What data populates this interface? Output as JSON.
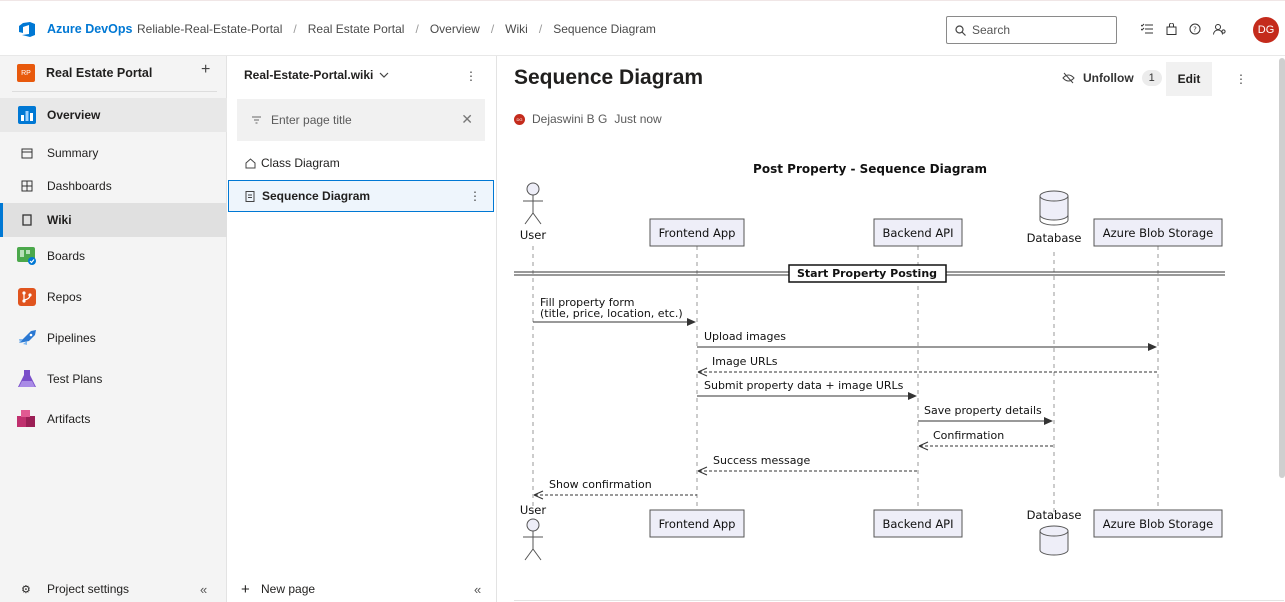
{
  "brand": "Azure DevOps",
  "breadcrumb": [
    "Reliable-Real-Estate-Portal",
    "Real Estate Portal",
    "Overview",
    "Wiki",
    "Sequence Diagram"
  ],
  "search": {
    "placeholder": "Search"
  },
  "user_initials": "DG",
  "project": {
    "badge": "RP",
    "name": "Real Estate Portal"
  },
  "nav": [
    {
      "label": "Overview",
      "icon": "overview-icon"
    },
    {
      "label": "Summary",
      "icon": "summary-icon"
    },
    {
      "label": "Dashboards",
      "icon": "dashboards-icon"
    },
    {
      "label": "Wiki",
      "icon": "wiki-icon"
    },
    {
      "label": "Boards",
      "icon": "boards-icon"
    },
    {
      "label": "Repos",
      "icon": "repos-icon"
    },
    {
      "label": "Pipelines",
      "icon": "pipelines-icon"
    },
    {
      "label": "Test Plans",
      "icon": "test-plans-icon"
    },
    {
      "label": "Artifacts",
      "icon": "artifacts-icon"
    }
  ],
  "project_settings": "Project settings",
  "wiki": {
    "name": "Real-Estate-Portal.wiki",
    "filter_placeholder": "Enter page title",
    "pages": [
      "Class Diagram",
      "Sequence Diagram"
    ],
    "new_page": "New page"
  },
  "page": {
    "title": "Sequence Diagram",
    "follow_label": "Unfollow",
    "follow_count": "1",
    "edit_label": "Edit",
    "author": "Dejaswini B G",
    "author_initials": "DG",
    "time": "Just now"
  },
  "diagram": {
    "title": "Post Property - Sequence Diagram",
    "participants": [
      "User",
      "Frontend App",
      "Backend API",
      "Database",
      "Azure Blob Storage"
    ],
    "divider": "Start Property Posting",
    "messages": [
      {
        "from": "User",
        "to": "Frontend App",
        "lines": [
          "Fill property form",
          "(title, price, location, etc.)"
        ],
        "style": "solid"
      },
      {
        "from": "Frontend App",
        "to": "Azure Blob Storage",
        "lines": [
          "Upload images"
        ],
        "style": "solid"
      },
      {
        "from": "Azure Blob Storage",
        "to": "Frontend App",
        "lines": [
          "Image URLs"
        ],
        "style": "dashed"
      },
      {
        "from": "Frontend App",
        "to": "Backend API",
        "lines": [
          "Submit property data + image URLs"
        ],
        "style": "solid"
      },
      {
        "from": "Backend API",
        "to": "Database",
        "lines": [
          "Save property details"
        ],
        "style": "solid"
      },
      {
        "from": "Database",
        "to": "Backend API",
        "lines": [
          "Confirmation"
        ],
        "style": "dashed"
      },
      {
        "from": "Backend API",
        "to": "Frontend App",
        "lines": [
          "Success message"
        ],
        "style": "dashed"
      },
      {
        "from": "Frontend App",
        "to": "User",
        "lines": [
          "Show confirmation"
        ],
        "style": "dashed"
      }
    ]
  }
}
